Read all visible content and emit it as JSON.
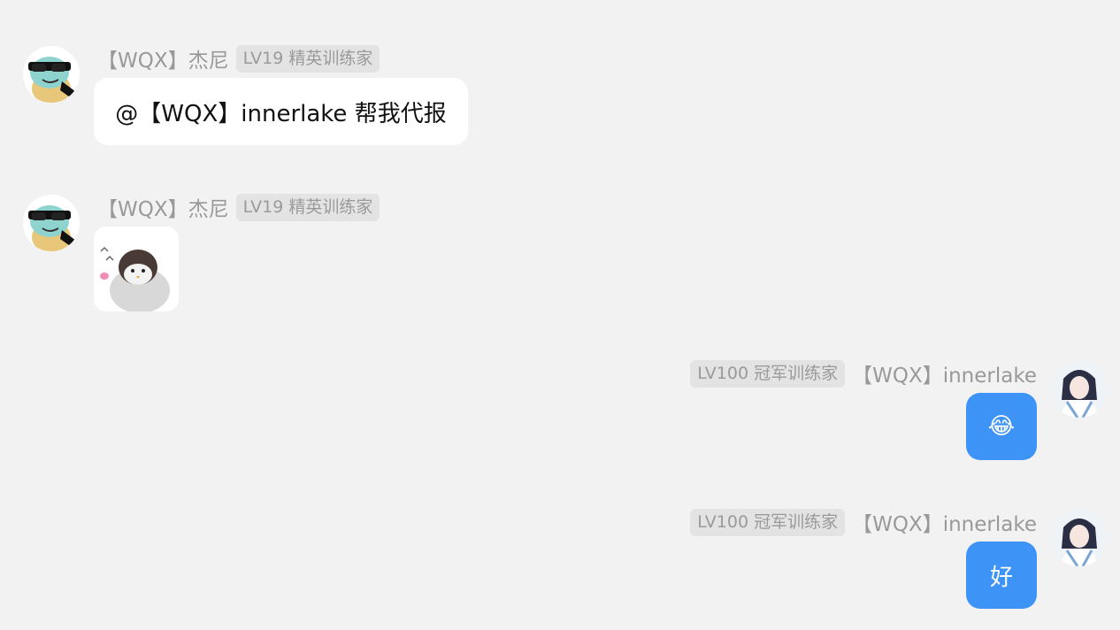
{
  "messages": [
    {
      "sender": "【WQX】杰尼",
      "level": "LV19 精英训练家",
      "text": "@【WQX】innerlake 帮我代报"
    },
    {
      "sender": "【WQX】杰尼",
      "level": "LV19 精英训练家",
      "sticker": "penguin-sticker"
    },
    {
      "sender": "【WQX】innerlake",
      "level": "LV100 冠军训练家",
      "text": "😂"
    },
    {
      "sender": "【WQX】innerlake",
      "level": "LV100 冠军训练家",
      "text": "好"
    }
  ],
  "colors": {
    "background": "#f2f2f2",
    "outgoing_bubble": "#3d94f6",
    "incoming_bubble": "#ffffff",
    "sender_name": "#999999",
    "badge_bg": "#e3e3e3"
  },
  "icons": {
    "jenny_avatar": "squirtle-sunglasses-avatar",
    "innerlake_avatar": "anime-character-avatar"
  }
}
